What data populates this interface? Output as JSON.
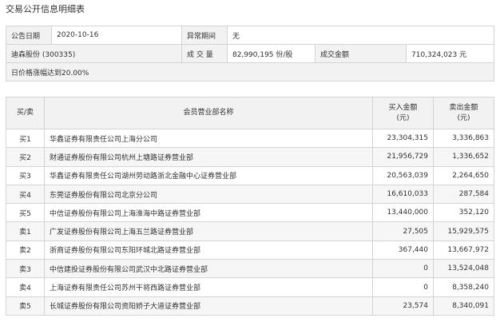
{
  "title": "交易公开信息明细表",
  "info": {
    "announce_date_label": "公告日期",
    "announce_date": "2020-10-16",
    "abnormal_period_label": "异常期间",
    "abnormal_period": "无",
    "stock": "迪森股份 (300335)",
    "volume_label": "成 交 量",
    "volume": "82,990,195 份/股",
    "amount_label": "成交金额",
    "amount": "710,324,023 元",
    "reason": "日价格涨幅达到20.00%"
  },
  "table": {
    "headers": {
      "side": "买/卖",
      "dept": "会员营业部名称",
      "buy": "买入金额\n(元)",
      "sell": "卖出金额\n(元)"
    },
    "rows": [
      {
        "side": "买1",
        "dept": "华鑫证券有限责任公司上海分公司",
        "buy": "23,304,315",
        "sell": "3,336,863"
      },
      {
        "side": "买2",
        "dept": "财通证券股份有限公司杭州上塘路证券营业部",
        "buy": "21,956,729",
        "sell": "1,336,652"
      },
      {
        "side": "买3",
        "dept": "华鑫证券有限责任公司湖州劳动路浙北金融中心证券营业部",
        "buy": "20,563,039",
        "sell": "2,264,650"
      },
      {
        "side": "买4",
        "dept": "东莞证券股份有限公司北京分公司",
        "buy": "16,610,033",
        "sell": "287,584"
      },
      {
        "side": "买5",
        "dept": "中信证券股份有限公司上海淮海中路证券营业部",
        "buy": "13,440,000",
        "sell": "352,120"
      },
      {
        "side": "卖1",
        "dept": "广发证券股份有限公司上海五兰路证券营业部",
        "buy": "27,505",
        "sell": "15,929,575"
      },
      {
        "side": "卖2",
        "dept": "浙商证券股份有限公司东阳环城北路证券营业部",
        "buy": "367,440",
        "sell": "13,667,972"
      },
      {
        "side": "卖3",
        "dept": "中信建投证券股份有限公司武汉中北路证券营业部",
        "buy": "0",
        "sell": "13,524,048"
      },
      {
        "side": "卖4",
        "dept": "上海证券有限责任公司苏州干将西路证券营业部",
        "buy": "0",
        "sell": "8,358,240"
      },
      {
        "side": "卖5",
        "dept": "长城证券股份有限公司资阳娇子大道证券营业部",
        "buy": "23,574",
        "sell": "8,340,091"
      }
    ]
  }
}
